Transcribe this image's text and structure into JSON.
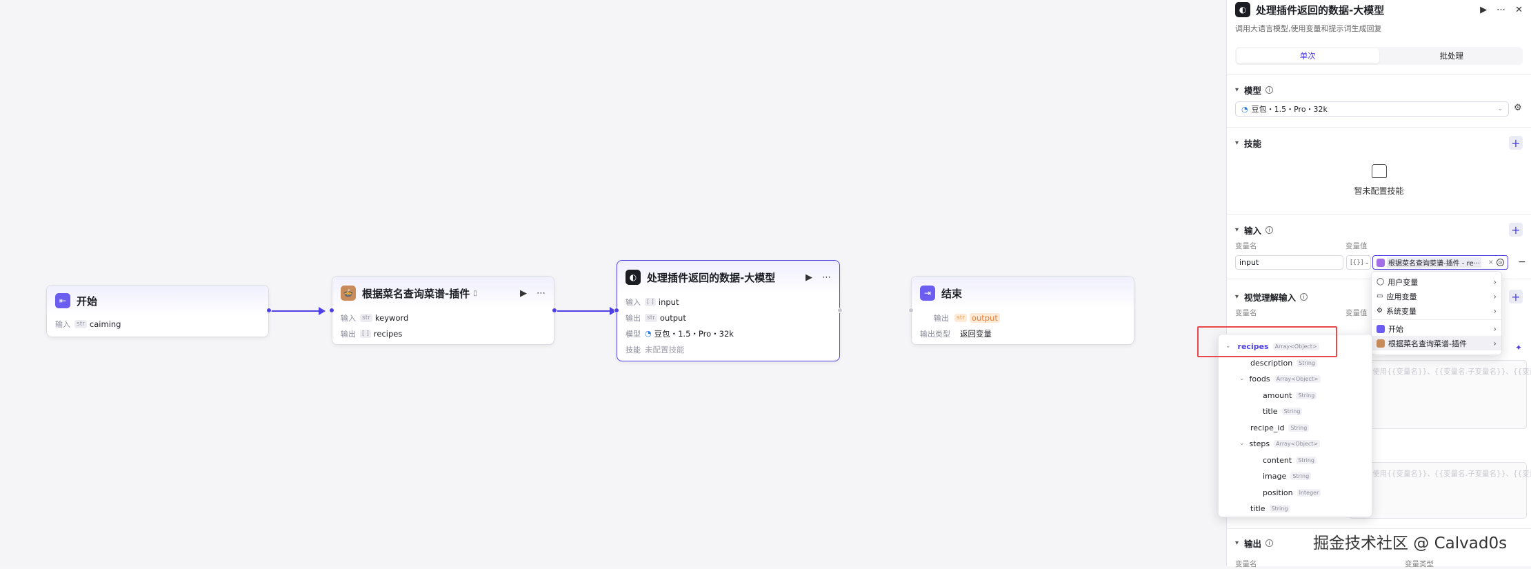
{
  "nodes": {
    "start": {
      "title": "开始",
      "in_label": "输入",
      "in_tag": "str",
      "in_value": "caiming"
    },
    "plugin": {
      "title": "根据菜名查询菜谱-插件",
      "in_label": "输入",
      "in_tag": "str",
      "in_value": "keyword",
      "out_label": "输出",
      "out_tag": "[ ]",
      "out_value": "recipes"
    },
    "llm": {
      "title": "处理插件返回的数据-大模型",
      "in_label": "输入",
      "in_tag": "[ ]",
      "in_value": "input",
      "out_label": "输出",
      "out_tag": "str",
      "out_value": "output",
      "model_label": "模型",
      "model_value": "豆包・1.5・Pro・32k",
      "skill_label": "技能",
      "skill_value": "未配置技能"
    },
    "end": {
      "title": "结束",
      "out_label": "输出",
      "out_tag": "str",
      "out_value": "output",
      "type_label": "输出类型",
      "type_value": "返回变量"
    }
  },
  "panel": {
    "title": "处理插件返回的数据-大模型",
    "desc": "调用大语言模型,使用变量和提示词生成回复",
    "tabs": [
      "单次",
      "批处理"
    ],
    "model_section": "模型",
    "model_value": "豆包・1.5・Pro・32k",
    "skill_section": "技能",
    "skill_empty": "暂未配置技能",
    "input_section": "输入",
    "var_name_label": "变量名",
    "var_value_label": "变量值",
    "input_name": "input",
    "input_type": "[{}]",
    "input_ref": "根据菜名查询菜谱-插件 - re···",
    "vision_section": "视觉理解输入",
    "vision_name_label": "变量名",
    "vision_value_label": "变量值",
    "placeholder1": "(可以使用{{变量名}}、{{变量名.子变量名}}、{{变量名[数组索引]}}的方",
    "placeholder2": "(可以使用{{变量名}}、{{变量名.子变量名}}、{{变量名[数组索引]}}的方",
    "output_section": "输出",
    "out_name_label": "变量名",
    "out_type_label": "变量类型"
  },
  "var_menu": [
    {
      "label": "用户变量",
      "icon": "user-icon"
    },
    {
      "label": "应用变量",
      "icon": "folder-icon"
    },
    {
      "label": "系统变量",
      "icon": "gear-icon"
    },
    {
      "label": "开始",
      "icon": "start-node-icon"
    },
    {
      "label": "根据菜名查询菜谱-插件",
      "icon": "plugin-node-icon"
    }
  ],
  "tree": [
    {
      "name": "recipes",
      "type": "Array<Object>"
    },
    {
      "name": "description",
      "type": "String"
    },
    {
      "name": "foods",
      "type": "Array<Object>"
    },
    {
      "name": "amount",
      "type": "String"
    },
    {
      "name": "title",
      "type": "String"
    },
    {
      "name": "recipe_id",
      "type": "String"
    },
    {
      "name": "steps",
      "type": "Array<Object>"
    },
    {
      "name": "content",
      "type": "String"
    },
    {
      "name": "image",
      "type": "String"
    },
    {
      "name": "position",
      "type": "Integer"
    },
    {
      "name": "title",
      "type": "String"
    }
  ],
  "watermark": "掘金技术社区 @ Calvad0s",
  "colors": {
    "accent": "#4e40e5",
    "highlight": "#e8474b"
  }
}
